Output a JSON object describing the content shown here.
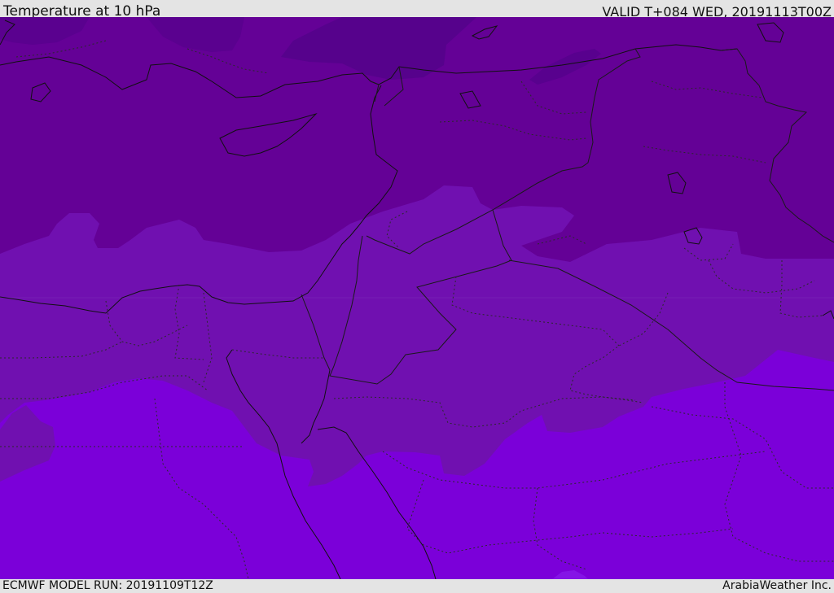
{
  "header": {
    "title": "Temperature at 10 hPa",
    "valid_time": "VALID T+084 WED, 20191113T00Z"
  },
  "footer": {
    "model_run": "ECMWF MODEL RUN: 20191109T12Z",
    "credit": "ArabiaWeather Inc."
  },
  "map": {
    "field": "temperature",
    "level": "10 hPa",
    "fill_colors": {
      "coldest": "#520088",
      "cold": "#640196",
      "mid": "#7010b0",
      "warm": "#7b00d9",
      "warmest": "#8610e8"
    },
    "line_colors": {
      "coastline": "#101010",
      "border": "#2a2a2a"
    }
  }
}
